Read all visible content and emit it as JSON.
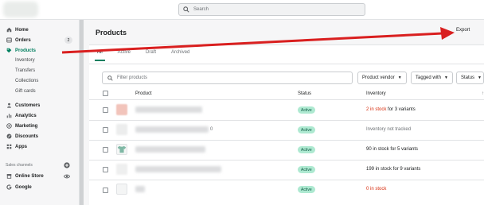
{
  "search": {
    "placeholder": "Search"
  },
  "sidebar": {
    "items": [
      {
        "label": "Home",
        "icon": "home-icon"
      },
      {
        "label": "Orders",
        "icon": "orders-icon",
        "badge": "2"
      },
      {
        "label": "Products",
        "icon": "tag-icon",
        "active": true
      },
      {
        "label": "Customers",
        "icon": "person-icon"
      },
      {
        "label": "Analytics",
        "icon": "bar-chart-icon"
      },
      {
        "label": "Marketing",
        "icon": "target-icon"
      },
      {
        "label": "Discounts",
        "icon": "discount-icon"
      },
      {
        "label": "Apps",
        "icon": "apps-grid-icon"
      }
    ],
    "product_subitems": [
      "Inventory",
      "Transfers",
      "Collections",
      "Gift cards"
    ],
    "sales_channels_heading": "Sales channels",
    "channels": [
      {
        "label": "Online Store",
        "icon": "store-icon"
      },
      {
        "label": "Google",
        "icon": "google-icon"
      }
    ]
  },
  "main": {
    "title": "Products",
    "export_label": "Export",
    "tabs": [
      "All",
      "Active",
      "Draft",
      "Archived"
    ],
    "filter_placeholder": "Filter products",
    "filter_buttons": [
      "Product vendor",
      "Tagged with",
      "Status"
    ],
    "columns": {
      "product": "Product",
      "status": "Status",
      "inventory": "Inventory"
    },
    "rows": [
      {
        "name_suffix": "",
        "status": "Active",
        "inventory_warn": "2 in stock",
        "inventory_rest": " for 3 variants"
      },
      {
        "name_suffix": "0",
        "status": "Active",
        "inventory_warn": "",
        "inventory_rest": "Inventory not tracked"
      },
      {
        "name_suffix": "",
        "status": "Active",
        "inventory_warn": "",
        "inventory_rest": "90 in stock for 5 variants"
      },
      {
        "name_suffix": "",
        "status": "Active",
        "inventory_warn": "",
        "inventory_rest": "199 in stock for 9 variants"
      },
      {
        "name_suffix": "",
        "status": "Active",
        "inventory_warn": "0 in stock",
        "inventory_rest": ""
      }
    ]
  },
  "colors": {
    "accent": "#008060",
    "arrow": "#d91f1f",
    "warn": "#d72c0d",
    "status_bg": "#aee9d1"
  }
}
